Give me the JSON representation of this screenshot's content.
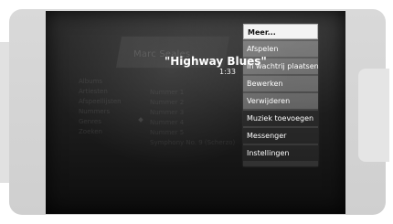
{
  "now_playing": {
    "title": "\"Highway Blues\"",
    "time": "1:33"
  },
  "background": {
    "album_line": "Marc Seales",
    "header_lines": [
      "",
      ""
    ],
    "left_list": [
      "Albums",
      "Artiesten",
      "Afspeellijsten",
      "Nummers",
      "Genres",
      "Zoeken"
    ],
    "track_list": [
      "Nummer 1",
      "Nummer 2",
      "Nummer 3",
      "Nummer 4",
      "Nummer 5",
      "Symphony No. 9 (Scherzo)"
    ]
  },
  "context_menu": {
    "items": [
      "Meer...",
      "Afspelen",
      "In wachtrij plaatsen",
      "Bewerken",
      "Verwijderen",
      "Muziek toevoegen",
      "Messenger",
      "Instellingen"
    ]
  }
}
